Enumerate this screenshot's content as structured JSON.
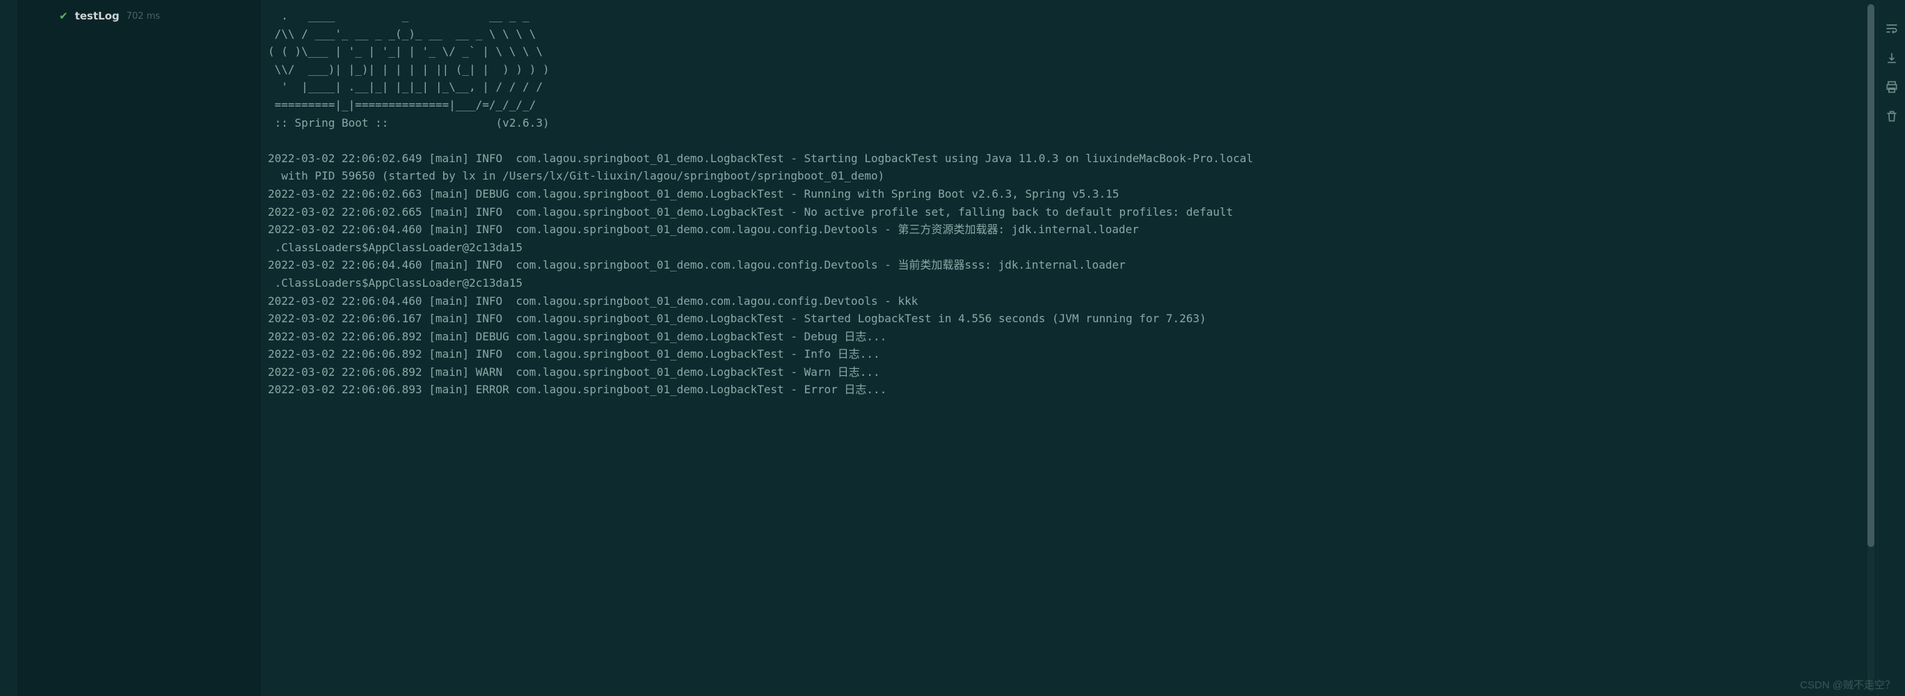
{
  "test_panel": {
    "status_icon": "pass",
    "test_name": "testLog",
    "duration": "702 ms"
  },
  "toolbar": {
    "icons": [
      "soft-wrap-icon",
      "scroll-to-end-icon",
      "print-icon",
      "clear-all-icon"
    ]
  },
  "console": {
    "ascii": "  .   ____          _            __ _ _\n /\\\\ / ___'_ __ _ _(_)_ __  __ _ \\ \\ \\ \\\n( ( )\\___ | '_ | '_| | '_ \\/ _` | \\ \\ \\ \\\n \\\\/  ___)| |_)| | | | | || (_| |  ) ) ) )\n  '  |____| .__|_| |_|_| |_\\__, | / / / /\n =========|_|==============|___/=/_/_/_/\n :: Spring Boot ::                (v2.6.3)\n",
    "lines": [
      "2022-03-02 22:06:02.649 [main] INFO  com.lagou.springboot_01_demo.LogbackTest - Starting LogbackTest using Java 11.0.3 on liuxindeMacBook-Pro.local",
      "  with PID 59650 (started by lx in /Users/lx/Git-liuxin/lagou/springboot/springboot_01_demo)",
      "2022-03-02 22:06:02.663 [main] DEBUG com.lagou.springboot_01_demo.LogbackTest - Running with Spring Boot v2.6.3, Spring v5.3.15",
      "2022-03-02 22:06:02.665 [main] INFO  com.lagou.springboot_01_demo.LogbackTest - No active profile set, falling back to default profiles: default",
      "2022-03-02 22:06:04.460 [main] INFO  com.lagou.springboot_01_demo.com.lagou.config.Devtools - 第三方资源类加载器: jdk.internal.loader",
      " .ClassLoaders$AppClassLoader@2c13da15",
      "2022-03-02 22:06:04.460 [main] INFO  com.lagou.springboot_01_demo.com.lagou.config.Devtools - 当前类加载器sss: jdk.internal.loader",
      " .ClassLoaders$AppClassLoader@2c13da15",
      "2022-03-02 22:06:04.460 [main] INFO  com.lagou.springboot_01_demo.com.lagou.config.Devtools - kkk",
      "2022-03-02 22:06:06.167 [main] INFO  com.lagou.springboot_01_demo.LogbackTest - Started LogbackTest in 4.556 seconds (JVM running for 7.263)",
      "2022-03-02 22:06:06.892 [main] DEBUG com.lagou.springboot_01_demo.LogbackTest - Debug 日志...",
      "2022-03-02 22:06:06.892 [main] INFO  com.lagou.springboot_01_demo.LogbackTest - Info 日志...",
      "2022-03-02 22:06:06.892 [main] WARN  com.lagou.springboot_01_demo.LogbackTest - Warn 日志...",
      "2022-03-02 22:06:06.893 [main] ERROR com.lagou.springboot_01_demo.LogbackTest - Error 日志..."
    ]
  },
  "watermark": "CSDN @贼不走空？"
}
